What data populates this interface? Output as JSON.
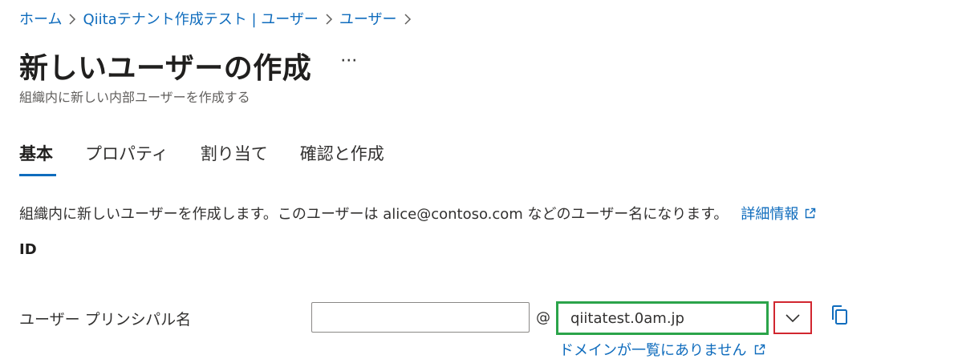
{
  "breadcrumb": {
    "items": [
      {
        "label": "ホーム"
      },
      {
        "label": "Qiitaテナント作成テスト | ユーザー"
      },
      {
        "label": "ユーザー"
      }
    ]
  },
  "header": {
    "title": "新しいユーザーの作成",
    "more_label": "···",
    "subtitle": "組織内に新しい内部ユーザーを作成する"
  },
  "tabs": [
    {
      "label": "基本",
      "active": true
    },
    {
      "label": "プロパティ",
      "active": false
    },
    {
      "label": "割り当て",
      "active": false
    },
    {
      "label": "確認と作成",
      "active": false
    }
  ],
  "main": {
    "description": "組織内に新しいユーザーを作成します。このユーザーは alice@contoso.com などのユーザー名になります。",
    "learn_more_label": "詳細情報",
    "section_heading": "ID",
    "upn": {
      "label": "ユーザー プリンシパル名",
      "value": "",
      "placeholder": "",
      "at_sign": "@",
      "domain_value": "qiitatest.0am.jp",
      "domain_missing_link": "ドメインが一覧にありません"
    }
  },
  "icons": {
    "chevron": "chevron-right-icon",
    "external": "external-link-icon",
    "dropdown": "chevron-down-icon",
    "copy": "copy-icon"
  },
  "colors": {
    "link": "#0f6cbd",
    "tab_active_underline": "#0f6cbd",
    "domain_highlight": "#2ba44a",
    "dropdown_highlight": "#d1262f"
  }
}
